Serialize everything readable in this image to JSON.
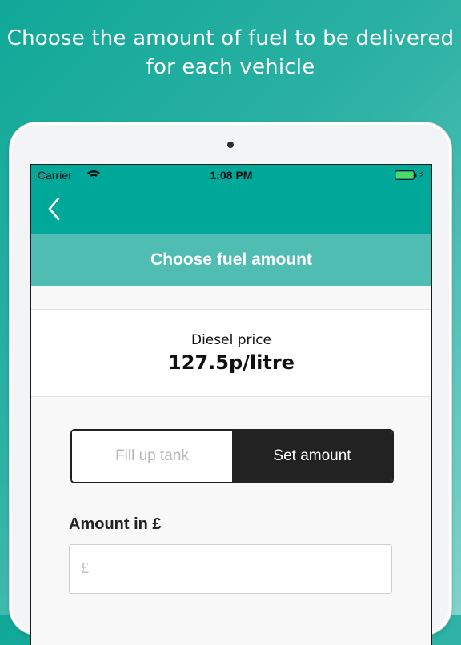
{
  "headline": {
    "line1": "Choose the amount of fuel to be delivered",
    "line2": "for each vehicle"
  },
  "status_bar": {
    "carrier": "Carrier",
    "time": "1:08 PM",
    "battery_icon": "battery-charging-icon",
    "wifi_icon": "wifi-icon"
  },
  "nav": {
    "back_icon": "chevron-left-icon",
    "title": "Choose fuel amount"
  },
  "price": {
    "label": "Diesel price",
    "value": "127.5p/litre"
  },
  "segment": {
    "options": [
      "Fill up tank",
      "Set amount"
    ],
    "selected": "Set amount"
  },
  "amount": {
    "label": "Amount in £",
    "prefix": "£",
    "value": ""
  },
  "colors": {
    "accent": "#00a89a",
    "title_bar": "#4fbdb2",
    "selected_segment": "#222222"
  }
}
